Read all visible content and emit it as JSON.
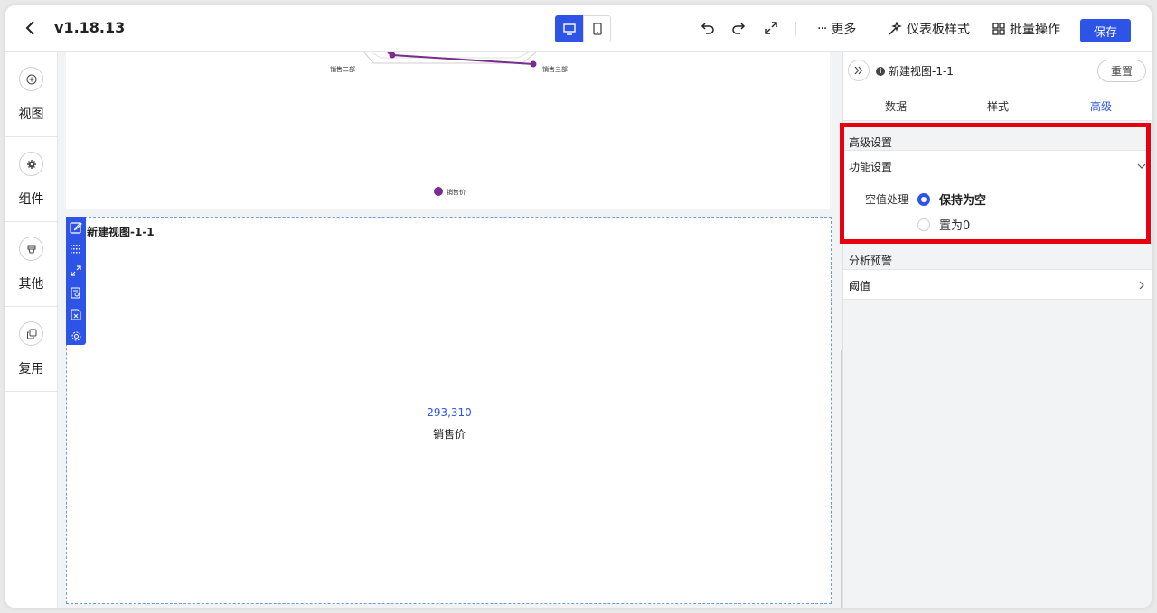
{
  "header": {
    "version": "v1.18.13",
    "more_label": "更多",
    "dashboard_style_label": "仪表板样式",
    "batch_label": "批量操作",
    "save_label": "保存"
  },
  "sidebar": {
    "items": [
      {
        "label": "视图",
        "icon": "plus-circle-icon"
      },
      {
        "label": "组件",
        "icon": "gear-icon"
      },
      {
        "label": "其他",
        "icon": "cup-icon"
      },
      {
        "label": "复用",
        "icon": "copy-icon"
      }
    ]
  },
  "radar_chart": {
    "axis_labels": [
      "销售二部",
      "销售三部"
    ],
    "legend": "销售价",
    "series_color": "#7b2d8e"
  },
  "kpi_card": {
    "title": "新建视图-1-1",
    "value": "293,310",
    "label": "销售价"
  },
  "panel": {
    "title": "新建视图-1-1",
    "reset_label": "重置",
    "tabs": [
      "数据",
      "样式",
      "高级"
    ],
    "active_tab": "高级",
    "advanced_section": "高级设置",
    "function_settings": "功能设置",
    "null_handling_label": "空值处理",
    "null_options": [
      "保持为空",
      "置为0"
    ],
    "selected_null_option": "保持为空",
    "analysis_section": "分析预警",
    "threshold_label": "阈值"
  },
  "colors": {
    "accent": "#2d54e6",
    "highlight": "#e8000f"
  }
}
